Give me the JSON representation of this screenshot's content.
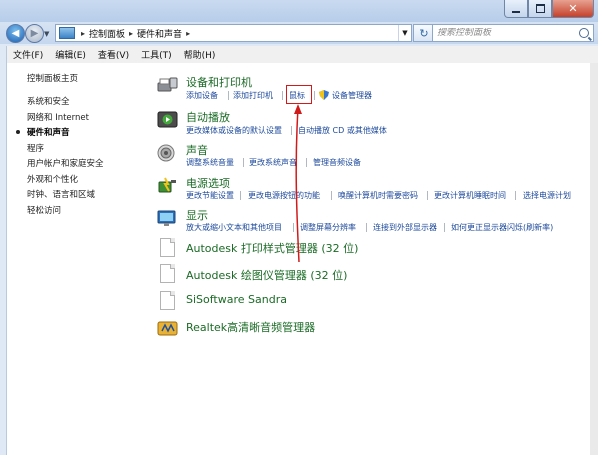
{
  "address": {
    "crumbs": [
      "控制面板",
      "硬件和声音"
    ],
    "search_placeholder": "搜索控制面板"
  },
  "menu": [
    "文件(F)",
    "编辑(E)",
    "查看(V)",
    "工具(T)",
    "帮助(H)"
  ],
  "sidebar": {
    "items": [
      {
        "label": "控制面板主页"
      },
      {
        "label": "系统和安全"
      },
      {
        "label": "网络和 Internet"
      },
      {
        "label": "硬件和声音",
        "active": true
      },
      {
        "label": "程序"
      },
      {
        "label": "用户帐户和家庭安全"
      },
      {
        "label": "外观和个性化"
      },
      {
        "label": "时钟、语言和区域"
      },
      {
        "label": "轻松访问"
      }
    ]
  },
  "categories": [
    {
      "title": "设备和打印机",
      "icon": "printer-icon",
      "links": [
        "添加设备",
        "添加打印机",
        "鼠标",
        "设备管理器"
      ]
    },
    {
      "title": "自动播放",
      "icon": "autoplay-icon",
      "links": [
        "更改媒体或设备的默认设置",
        "自动播放 CD 或其他媒体"
      ]
    },
    {
      "title": "声音",
      "icon": "speaker-icon",
      "links": [
        "调整系统音量",
        "更改系统声音",
        "管理音频设备"
      ]
    },
    {
      "title": "电源选项",
      "icon": "power-icon",
      "links": [
        "更改节能设置",
        "更改电源按钮的功能",
        "唤醒计算机时需要密码",
        "更改计算机睡眠时间",
        "选择电源计划"
      ]
    },
    {
      "title": "显示",
      "icon": "display-icon",
      "links": [
        "放大或缩小文本和其他项目",
        "调整屏幕分辨率",
        "连接到外部显示器",
        "如何更正显示器闪烁(刷新率)"
      ]
    }
  ],
  "programs": [
    {
      "title": "Autodesk 打印样式管理器 (32 位)",
      "icon": "document-icon"
    },
    {
      "title": "Autodesk 绘图仪管理器 (32 位)",
      "icon": "document-icon"
    },
    {
      "title": "SiSoftware Sandra",
      "icon": "document-icon"
    },
    {
      "title": "Realtek高清晰音频管理器",
      "icon": "realtek-audio-icon"
    }
  ],
  "colors": {
    "highlight": "#d11b1b",
    "category_title": "#1a6b25",
    "link": "#1d4a9c"
  }
}
